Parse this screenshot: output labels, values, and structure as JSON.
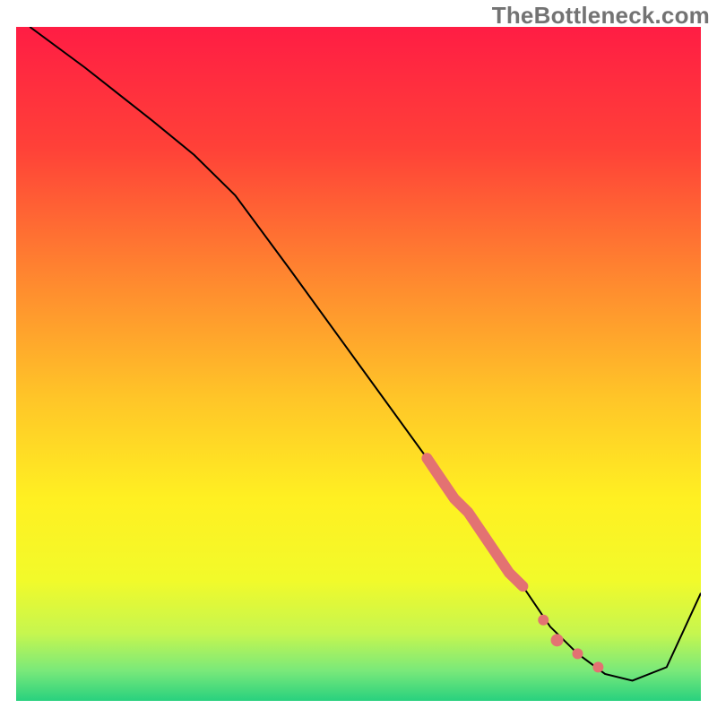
{
  "watermark": "TheBottleneck.com",
  "chart_data": {
    "type": "line",
    "title": "",
    "xlabel": "",
    "ylabel": "",
    "xlim": [
      0,
      100
    ],
    "ylim": [
      0,
      100
    ],
    "grid": false,
    "legend": false,
    "background_gradient_stops": [
      {
        "pct": 0.0,
        "color": "#ff1d44"
      },
      {
        "pct": 0.18,
        "color": "#ff4138"
      },
      {
        "pct": 0.38,
        "color": "#ff8a2f"
      },
      {
        "pct": 0.55,
        "color": "#ffc528"
      },
      {
        "pct": 0.7,
        "color": "#fff022"
      },
      {
        "pct": 0.82,
        "color": "#f2fa2a"
      },
      {
        "pct": 0.9,
        "color": "#c6f64f"
      },
      {
        "pct": 0.955,
        "color": "#7ae97a"
      },
      {
        "pct": 1.0,
        "color": "#28d17e"
      }
    ],
    "series": [
      {
        "name": "bottleneck-curve",
        "color": "#000000",
        "width": 2.0,
        "x": [
          2,
          10,
          20,
          26,
          32,
          40,
          50,
          60,
          68,
          74,
          78,
          82,
          86,
          90,
          95,
          100
        ],
        "y": [
          100,
          94,
          86,
          81,
          75,
          64,
          50,
          36,
          25,
          17,
          11,
          7,
          4,
          3,
          5,
          16
        ]
      }
    ],
    "highlight_segment": {
      "color": "#e37272",
      "width_start": 11,
      "width_end": 5,
      "x": [
        60,
        62,
        64,
        66,
        68,
        70,
        72,
        74
      ],
      "y": [
        36,
        33,
        30,
        28,
        25,
        22,
        19,
        17
      ]
    },
    "highlight_dots": {
      "color": "#e37272",
      "points": [
        {
          "x": 77,
          "y": 12,
          "r": 6
        },
        {
          "x": 79,
          "y": 9,
          "r": 7
        },
        {
          "x": 82,
          "y": 7,
          "r": 6
        },
        {
          "x": 85,
          "y": 5,
          "r": 6
        }
      ]
    }
  }
}
